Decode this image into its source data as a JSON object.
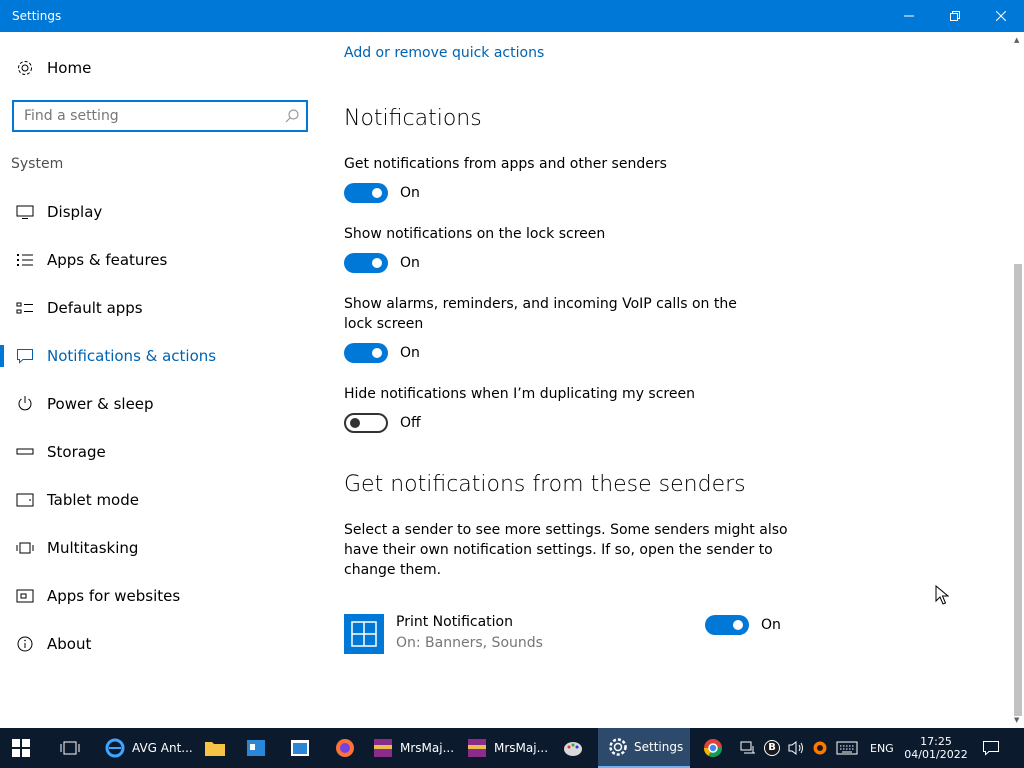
{
  "window": {
    "title": "Settings"
  },
  "sidebar": {
    "home_label": "Home",
    "search_placeholder": "Find a setting",
    "section_label": "System",
    "items": [
      {
        "label": "Display",
        "icon": "monitor-icon"
      },
      {
        "label": "Apps & features",
        "icon": "list-icon"
      },
      {
        "label": "Default apps",
        "icon": "default-apps-icon"
      },
      {
        "label": "Notifications & actions",
        "icon": "message-icon",
        "active": true
      },
      {
        "label": "Power & sleep",
        "icon": "power-icon"
      },
      {
        "label": "Storage",
        "icon": "storage-icon"
      },
      {
        "label": "Tablet mode",
        "icon": "tablet-icon"
      },
      {
        "label": "Multitasking",
        "icon": "multitask-icon"
      },
      {
        "label": "Apps for websites",
        "icon": "apps-websites-icon"
      },
      {
        "label": "About",
        "icon": "info-icon"
      }
    ]
  },
  "main": {
    "quick_actions_link": "Add or remove quick actions",
    "notifications_heading": "Notifications",
    "settings": [
      {
        "label": "Get notifications from apps and other senders",
        "state": "On"
      },
      {
        "label": "Show notifications on the lock screen",
        "state": "On"
      },
      {
        "label": "Show alarms, reminders, and incoming VoIP calls on the lock screen",
        "state": "On"
      },
      {
        "label": "Hide notifications when I’m duplicating my screen",
        "state": "Off"
      }
    ],
    "senders_heading": "Get notifications from these senders",
    "senders_desc": "Select a sender to see more settings. Some senders might also have their own notification settings. If so, open the sender to change them.",
    "sender": {
      "name": "Print Notification",
      "sub": "On: Banners, Sounds",
      "state": "On"
    }
  },
  "taskbar": {
    "apps": [
      {
        "label": "AVG Ant...",
        "icon": "ie-icon"
      },
      {
        "label": "MrsMaj...",
        "icon": "winrar-icon"
      },
      {
        "label": "MrsMaj...",
        "icon": "winrar-icon"
      },
      {
        "label": "Settings",
        "icon": "gear-icon",
        "active": true
      }
    ],
    "tray": {
      "b_label": "B",
      "lang": "ENG",
      "time": "17:25",
      "date": "04/01/2022"
    }
  },
  "colors": {
    "accent": "#0078d7",
    "link": "#0063b1",
    "taskbar": "#0c1a2e"
  }
}
